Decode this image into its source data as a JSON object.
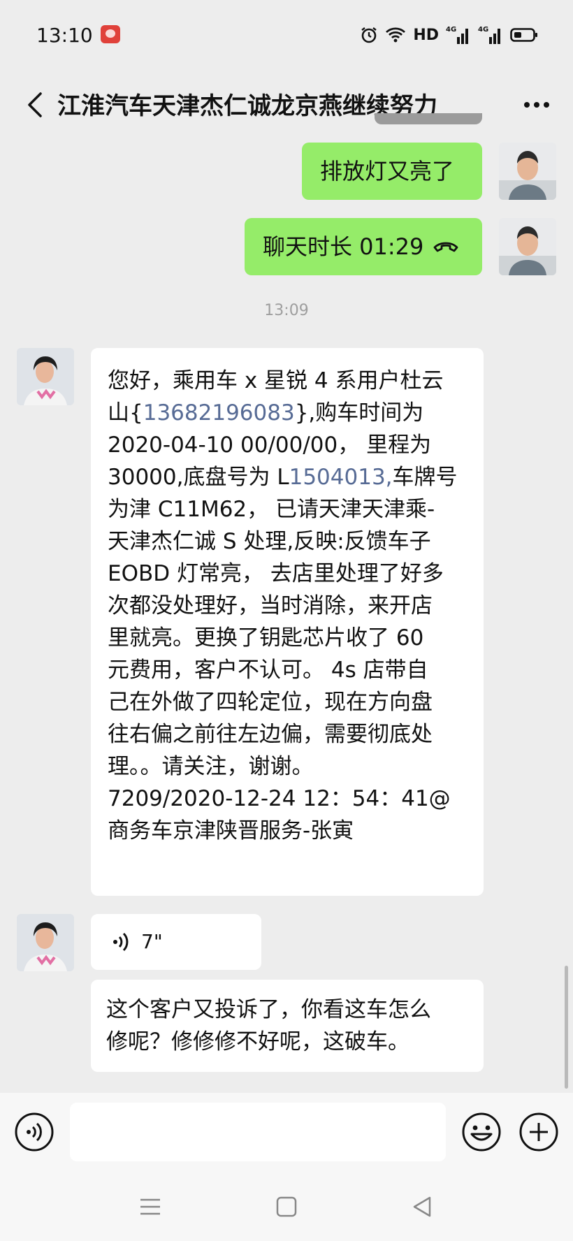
{
  "status_bar": {
    "time": "13:10",
    "network": "HD",
    "signal1": "4G",
    "signal2": "4G"
  },
  "chat": {
    "title": "江淮汽车天津杰仁诚龙京燕继续努力"
  },
  "messages": {
    "m1": "排放灯又亮了",
    "call": "聊天时长 01:29",
    "timestamp": "13:09",
    "m3": {
      "t1": "您好，乘用车 x 星锐 4 系用户杜云",
      "t2a": "山{",
      "t2b": "13682196083",
      "t2c": "},购车时间为",
      "t3": "2020-04-10 00/00/00， 里程为",
      "t4a": "30000,底盘号为 L",
      "t4b": "1504013,",
      "t4c": "车牌号",
      "t5": "为津 C11M62， 已请天津天津乘-",
      "t6": "天津杰仁诚 S 处理,反映:反馈车子",
      "t7": "EOBD 灯常亮， 去店里处理了好多",
      "t8": "次都没处理好，当时消除，来开店",
      "t9": "里就亮。更换了钥匙芯片收了 60",
      "t10": "元费用，客户不认可。 4s 店带自",
      "t11": "己在外做了四轮定位，现在方向盘",
      "t12": "往右偏之前往左边偏，需要彻底处",
      "t13": "理。。请关注，谢谢。",
      "t14": "7209/2020-12-24 12：54：41@",
      "t15": "商务车京津陕晋服务-张寅"
    },
    "voice_duration": "7\"",
    "m5": {
      "t1": "这个客户又投诉了，你看这车怎么",
      "t2": "修呢？修修修不好呢，这破车。"
    }
  },
  "composer": {
    "placeholder": ""
  },
  "icons": {
    "back": "chevron-left-icon",
    "more": "more-dots-icon",
    "voice_input": "voice-input-icon",
    "emoji": "emoji-icon",
    "add": "plus-icon",
    "call": "phone-hangup-icon",
    "voice_msg": "voice-wave-icon",
    "nav_menu": "menu-icon",
    "nav_home": "home-square-icon",
    "nav_back": "back-triangle-icon"
  },
  "colors": {
    "my_bubble": "#95ec69",
    "their_bubble": "#ffffff",
    "background": "#ededed",
    "link": "#576b95"
  }
}
